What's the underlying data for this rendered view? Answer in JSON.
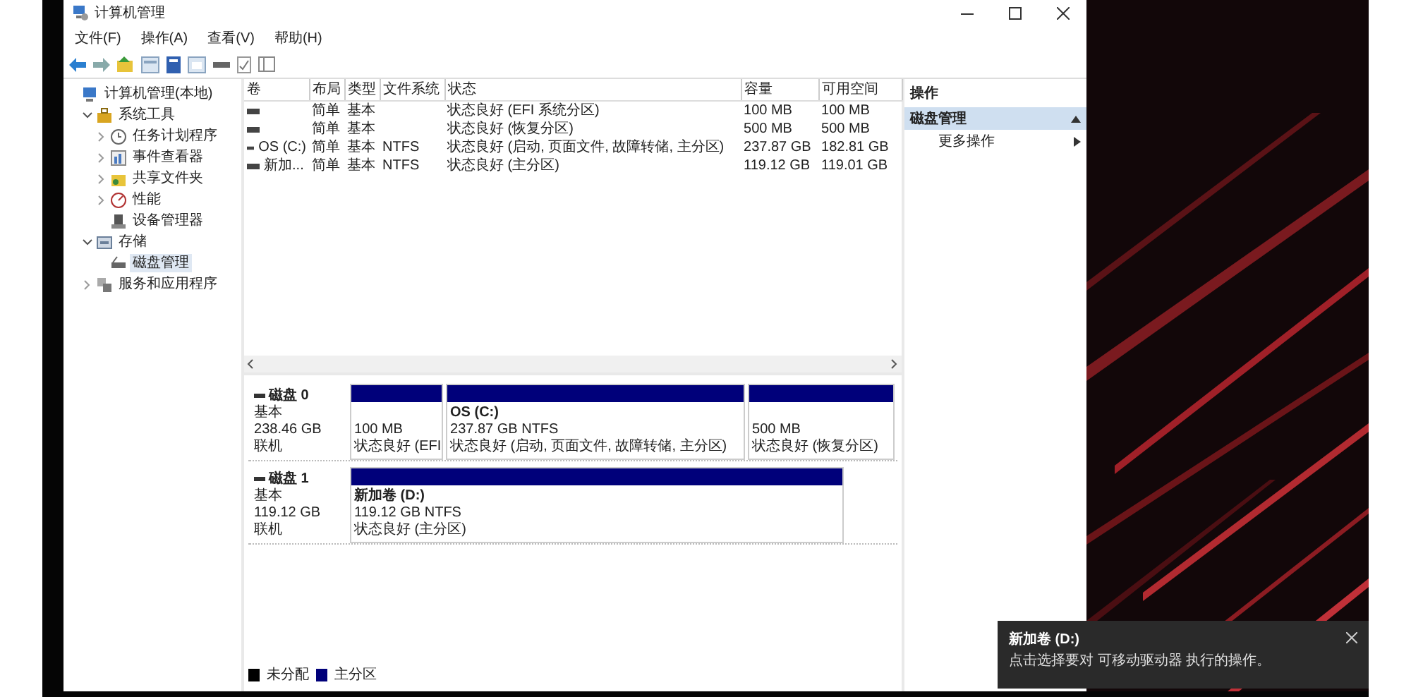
{
  "window": {
    "title": "计算机管理"
  },
  "menu": [
    "文件(F)",
    "操作(A)",
    "查看(V)",
    "帮助(H)"
  ],
  "tree": [
    {
      "label": "计算机管理(本地)",
      "kind": "computer",
      "selected": false,
      "children": [
        {
          "label": "系统工具",
          "kind": "tools",
          "expanded": true,
          "selected": false,
          "children": [
            {
              "label": "任务计划程序",
              "kind": "clock",
              "expanded": false,
              "selected": false
            },
            {
              "label": "事件查看器",
              "kind": "log",
              "expanded": false,
              "selected": false
            },
            {
              "label": "共享文件夹",
              "kind": "folder",
              "expanded": false,
              "selected": false
            },
            {
              "label": "性能",
              "kind": "perf",
              "expanded": false,
              "selected": false
            },
            {
              "label": "设备管理器",
              "kind": "device",
              "selected": false
            }
          ]
        },
        {
          "label": "存储",
          "kind": "storage",
          "expanded": true,
          "selected": false,
          "children": [
            {
              "label": "磁盘管理",
              "kind": "disk",
              "selected": true
            }
          ]
        },
        {
          "label": "服务和应用程序",
          "kind": "services",
          "expanded": false,
          "selected": false
        }
      ]
    }
  ],
  "table": {
    "columns": [
      "卷",
      "布局",
      "类型",
      "文件系统",
      "状态",
      "容量",
      "可用空间"
    ],
    "rows": [
      {
        "layout": "简单",
        "type": "基本",
        "status": "状态良好 (EFI 系统分区)",
        "capacity": "100 MB",
        "free": "100 MB"
      },
      {
        "layout": "简单",
        "type": "基本",
        "status": "状态良好 (恢复分区)",
        "capacity": "500 MB",
        "free": "500 MB"
      },
      {
        "volume": "OS (C:)",
        "layout": "简单",
        "type": "基本",
        "filesystem": "NTFS",
        "status": "状态良好 (启动, 页面文件, 故障转储, 主分区)",
        "capacity": "237.87 GB",
        "free": "182.81 GB"
      },
      {
        "volume": "新加...",
        "layout": "简单",
        "type": "基本",
        "filesystem": "NTFS",
        "status": "状态良好 (主分区)",
        "capacity": "119.12 GB",
        "free": "119.01 GB"
      }
    ]
  },
  "disks": [
    {
      "name": "磁盘 0",
      "type": "基本",
      "size": "238.46 GB",
      "state": "联机",
      "partitions": [
        {
          "size": "100 MB",
          "status": "状态良好 (EFI"
        },
        {
          "title": "OS (C:)",
          "size": "237.87 GB NTFS",
          "status": "状态良好 (启动, 页面文件, 故障转储, 主分区)"
        },
        {
          "size": "500 MB",
          "status": "状态良好 (恢复分区)"
        }
      ]
    },
    {
      "name": "磁盘 1",
      "type": "基本",
      "size": "119.12 GB",
      "state": "联机",
      "partitions": [
        {
          "title": "新加卷 (D:)",
          "size": "119.12 GB NTFS",
          "status": "状态良好 (主分区)"
        }
      ]
    }
  ],
  "legend": [
    {
      "label": "未分配",
      "color": "#000000"
    },
    {
      "label": "主分区",
      "color": "#00007a"
    }
  ],
  "actions": {
    "header": "操作",
    "items": [
      {
        "label": "磁盘管理",
        "kind": "section",
        "selected": true
      },
      {
        "label": "更多操作",
        "kind": "submenu",
        "selected": false
      }
    ]
  },
  "toast": {
    "title": "新加卷 (D:)",
    "message": "点击选择要对 可移动驱动器 执行的操作。"
  }
}
